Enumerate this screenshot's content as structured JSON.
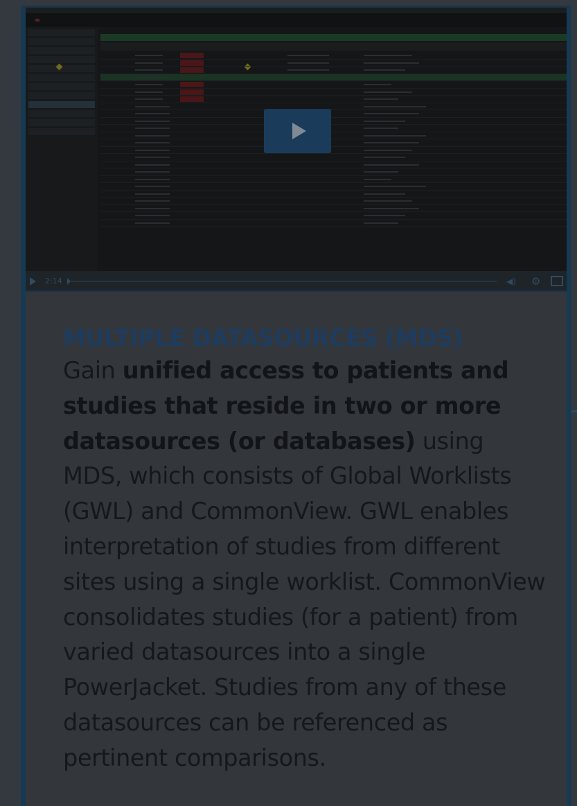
{
  "video": {
    "elapsed_time": "2:14",
    "play_icon": "play-icon",
    "volume_icon": "volume-icon",
    "settings_icon": "gear-icon",
    "fullscreen_icon": "fullscreen-icon"
  },
  "section": {
    "heading": "MULTIPLE DATASOURCES (MDS)",
    "intro": "Gain ",
    "bold_phrase": "unified access to patients and studies that reside in two or more datasources (or databases)",
    "rest": " using MDS, which consists of Global Worklists (GWL) and CommonView. GWL enables interpretation of studies from different sites using a single worklist. CommonView consolidates studies (for a patient) from varied datasources into a single PowerJacket. Studies from any of these datasources can be referenced as pertinent comparisons."
  },
  "colors": {
    "overlay_bg": "#34393f",
    "heading": "#1e3c5e",
    "body_text": "#15181b",
    "border_accent": "#173a52"
  }
}
